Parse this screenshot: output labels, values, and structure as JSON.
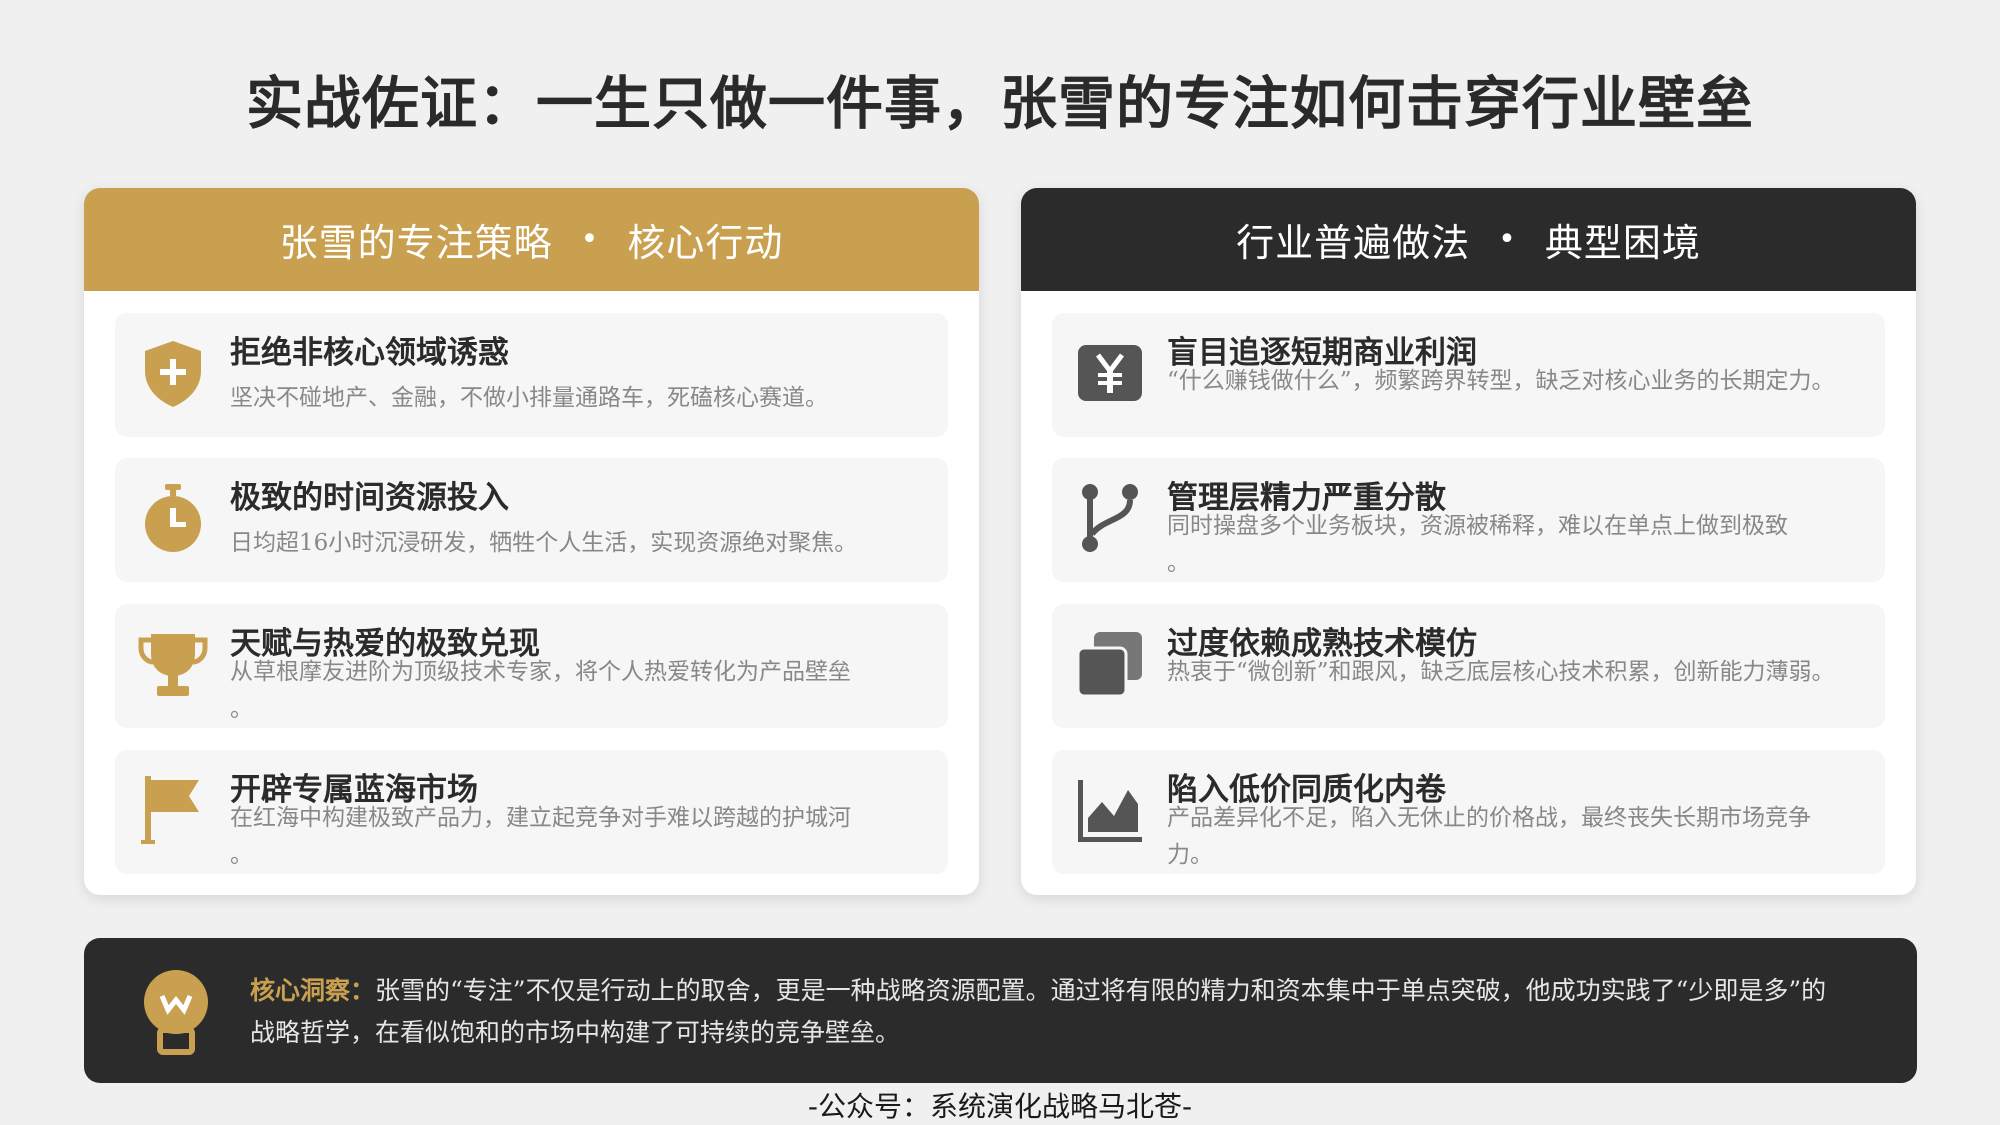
{
  "title": "实战佐证：一生只做一件事，张雪的专注如何击穿行业壁垒",
  "left_panel": {
    "header_left": "张雪的专注策略",
    "header_sep": "•",
    "header_right": "核心行动",
    "accent": "#c9a050",
    "items": [
      {
        "icon": "shield-plus-icon",
        "title": "拒绝非核心领域诱惑",
        "desc": "坚决不碰地产、金融，不做小排量通路车，死磕核心赛道。"
      },
      {
        "icon": "stopwatch-icon",
        "title": "极致的时间资源投入",
        "desc": "日均超16小时沉浸研发，牺牲个人生活，实现资源绝对聚焦。"
      },
      {
        "icon": "trophy-icon",
        "title": "天赋与热爱的极致兑现",
        "desc": "从草根摩友进阶为顶级技术专家，将个人热爱转化为产品壁垒\n。"
      },
      {
        "icon": "flag-icon",
        "title": "开辟专属蓝海市场",
        "desc": "在红海中构建极致产品力，建立起竞争对手难以跨越的护城河\n。"
      }
    ]
  },
  "right_panel": {
    "header_left": "行业普遍做法",
    "header_sep": "•",
    "header_right": "典型困境",
    "accent": "#2b2b2b",
    "items": [
      {
        "icon": "yen-sign-icon",
        "title": "盲目追逐短期商业利润",
        "desc": "“什么赚钱做什么”，频繁跨界转型，缺乏对核心业务的长期定力。"
      },
      {
        "icon": "code-branch-icon",
        "title": "管理层精力严重分散",
        "desc": "同时操盘多个业务板块，资源被稀释，难以在单点上做到极致\n。"
      },
      {
        "icon": "clone-icon",
        "title": "过度依赖成熟技术模仿",
        "desc": "热衷于“微创新”和跟风，缺乏底层核心技术积累，创新能力薄弱。"
      },
      {
        "icon": "area-chart-icon",
        "title": "陷入低价同质化内卷",
        "desc": "产品差异化不足，陷入无休止的价格战，最终丧失长期市场竞争力。"
      }
    ]
  },
  "insight": {
    "icon": "lightbulb-icon",
    "label": "核心洞察：",
    "text": "张雪的“专注”不仅是行动上的取舍，更是一种战略资源配置。通过将有限的精力和资本集中于单点突破，他成功实践了“少即是多”的战略哲学，在看似饱和的市场中构建了可持续的竞争壁垒。"
  },
  "footer": "-公众号：系统演化战略马北苍-"
}
